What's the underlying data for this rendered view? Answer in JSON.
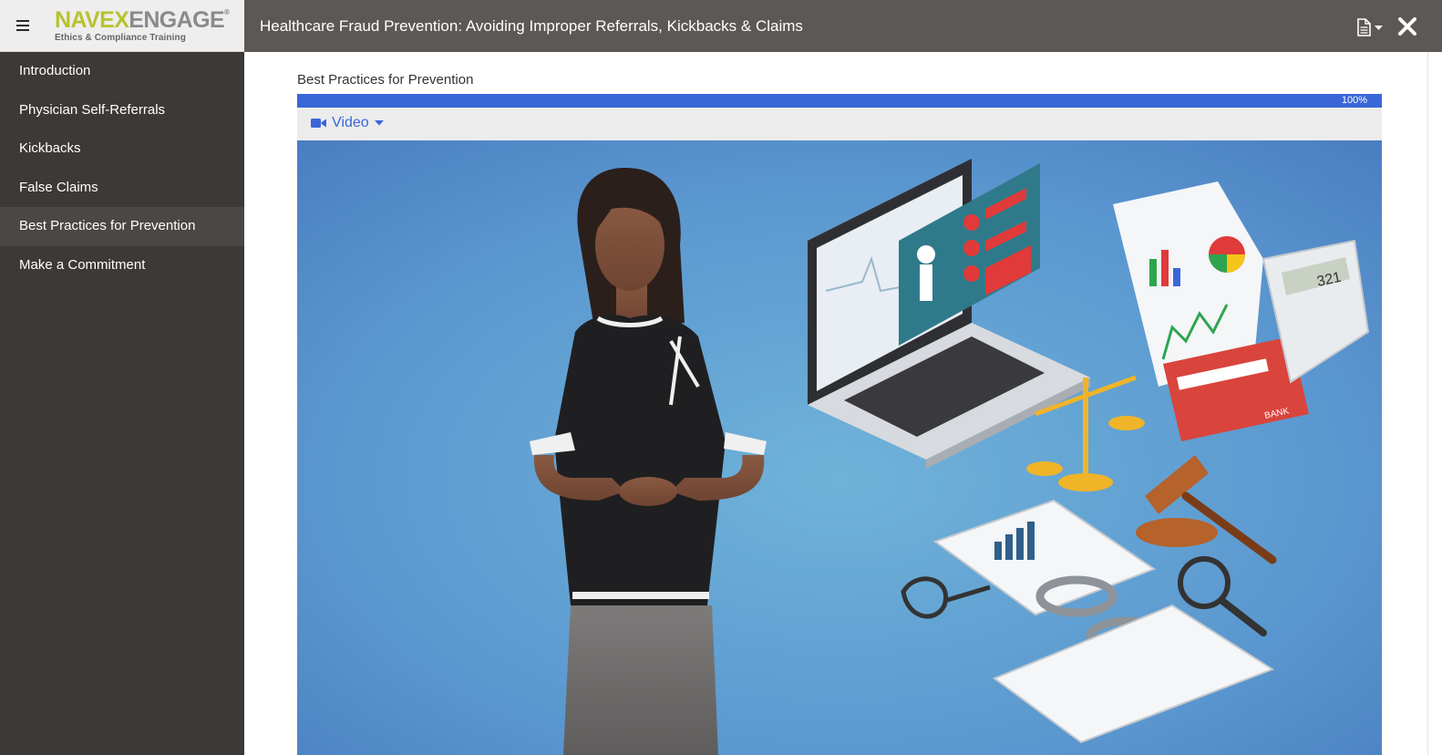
{
  "header": {
    "logo_navex": "NAVEX",
    "logo_engage": "ENGAGE",
    "logo_tagline": "Ethics & Compliance Training",
    "course_title": "Healthcare Fraud Prevention: Avoiding Improper Referrals, Kickbacks & Claims",
    "icons": [
      "menu-icon",
      "document-icon",
      "chevron-down-icon",
      "close-icon"
    ]
  },
  "sidebar": {
    "items": [
      {
        "label": "Introduction",
        "active": false
      },
      {
        "label": "Physician Self-Referrals",
        "active": false
      },
      {
        "label": "Kickbacks",
        "active": false
      },
      {
        "label": "False Claims",
        "active": false
      },
      {
        "label": "Best Practices for Prevention",
        "active": true
      },
      {
        "label": "Make a Commitment",
        "active": false
      }
    ]
  },
  "main": {
    "section_title": "Best Practices for Prevention",
    "progress": {
      "value": 1.0,
      "label": "100%"
    },
    "media_tab": {
      "label": "Video",
      "icon": "video-camera-icon"
    },
    "illustration": {
      "calculator_display": "321",
      "card_label": "BANK"
    }
  },
  "colors": {
    "accent_blue": "#3a66d8",
    "topbar": "#5c5856",
    "sidebar": "#3c3937",
    "logo_green": "#b7c330"
  }
}
